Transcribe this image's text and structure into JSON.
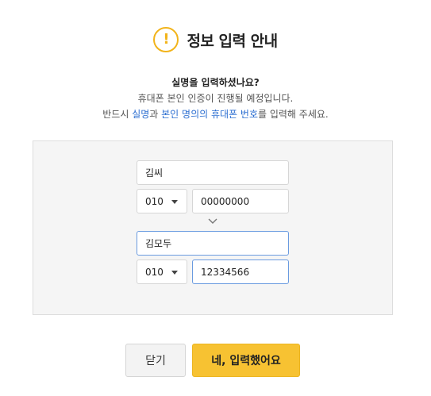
{
  "dialog": {
    "title": "정보 입력 안내",
    "icon": "exclamation-icon",
    "accent_color": "#f2b41b"
  },
  "message": {
    "question": "실명을 입력하셨나요?",
    "line1": "휴대폰 본인 인증이 진행될 예정입니다.",
    "line2_prefix": "반드시 ",
    "line2_hl1": "실명",
    "line2_mid": "과 ",
    "line2_hl2": "본인 명의의 휴대폰 번호",
    "line2_suffix": "를 입력해 주세요.",
    "highlight_color": "#2d6fd1"
  },
  "before": {
    "name": "김씨",
    "phone_prefix": "010",
    "phone_number": "00000000"
  },
  "after": {
    "name": "김모두",
    "phone_prefix": "010",
    "phone_number": "12334566"
  },
  "buttons": {
    "close": "닫기",
    "confirm": "네, 입력했어요",
    "confirm_color": "#f7c232"
  }
}
